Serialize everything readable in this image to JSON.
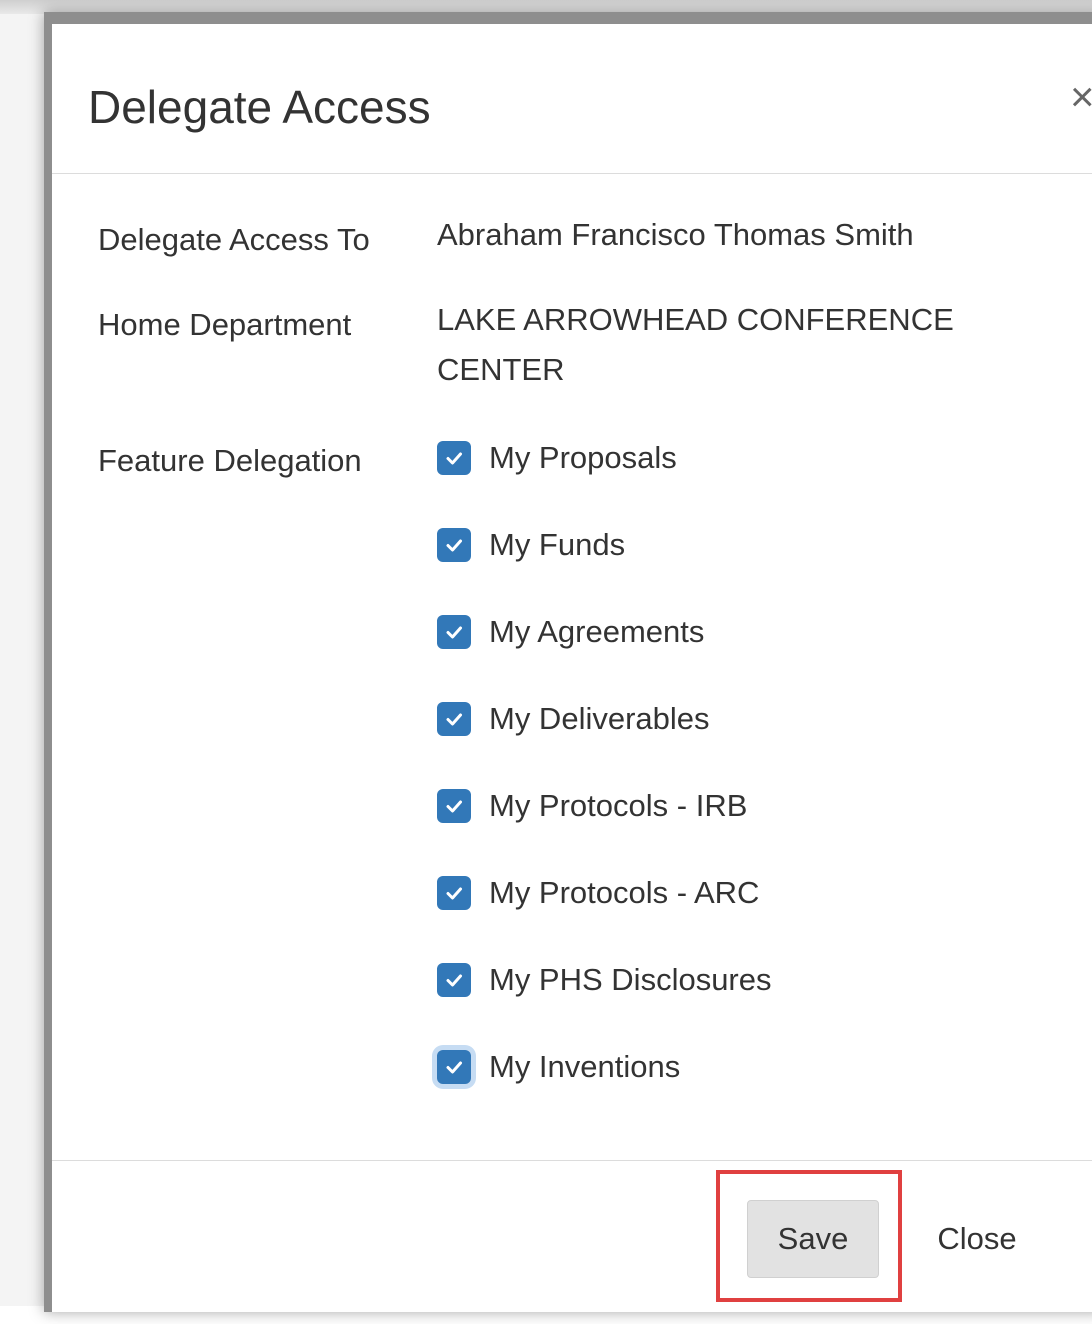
{
  "dialog": {
    "title": "Delegate Access",
    "close_icon_glyph": "×"
  },
  "fields": {
    "delegate_to": {
      "label": "Delegate Access To",
      "value": "Abraham Francisco Thomas Smith"
    },
    "home_department": {
      "label": "Home Department",
      "value_line1": "LAKE ARROWHEAD CONFERENCE",
      "value_line2": "CENTER"
    },
    "feature_delegation": {
      "label": "Feature Delegation",
      "items": [
        {
          "label": "My Proposals",
          "checked": true
        },
        {
          "label": "My Funds",
          "checked": true
        },
        {
          "label": "My Agreements",
          "checked": true
        },
        {
          "label": "My Deliverables",
          "checked": true
        },
        {
          "label": "My Protocols - IRB",
          "checked": true
        },
        {
          "label": "My Protocols - ARC",
          "checked": true
        },
        {
          "label": "My PHS Disclosures",
          "checked": true
        },
        {
          "label": "My Inventions",
          "checked": true
        }
      ]
    }
  },
  "footer": {
    "save_label": "Save",
    "close_label": "Close"
  },
  "colors": {
    "checkbox": "#3278b8",
    "highlight": "#e04040",
    "save_button_bg": "#e2e2e2"
  }
}
